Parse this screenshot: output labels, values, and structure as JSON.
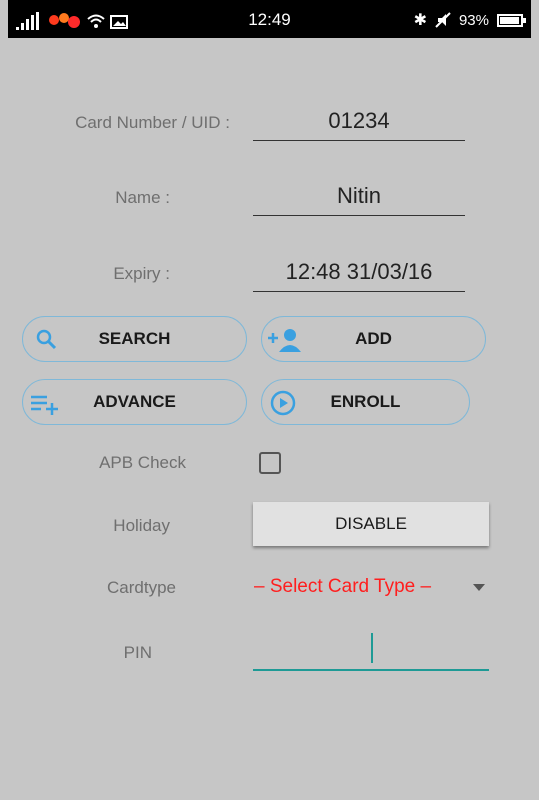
{
  "status_bar": {
    "time": "12:49",
    "battery": "93%",
    "battery_level": 0.93
  },
  "form": {
    "card_number_label": "Card Number / UID :",
    "card_number_value": "01234",
    "name_label": "Name :",
    "name_value": "Nitin",
    "expiry_label": "Expiry :",
    "expiry_value": "12:48 31/03/16",
    "apb_label": "APB Check",
    "apb_checked": false,
    "holiday_label": "Holiday",
    "holiday_button": "DISABLE",
    "cardtype_label": "Cardtype",
    "cardtype_selected": "– Select Card Type –",
    "pin_label": "PIN",
    "pin_value": ""
  },
  "buttons": {
    "search": "SEARCH",
    "add": "ADD",
    "advance": "ADVANCE",
    "enroll": "ENROLL"
  },
  "colors": {
    "background": "#c6c6c6",
    "pill_border": "#7fb8d8",
    "icon_blue": "#3aa0e0",
    "select_red": "#ff1e1e",
    "pin_teal": "#1e9a95"
  }
}
